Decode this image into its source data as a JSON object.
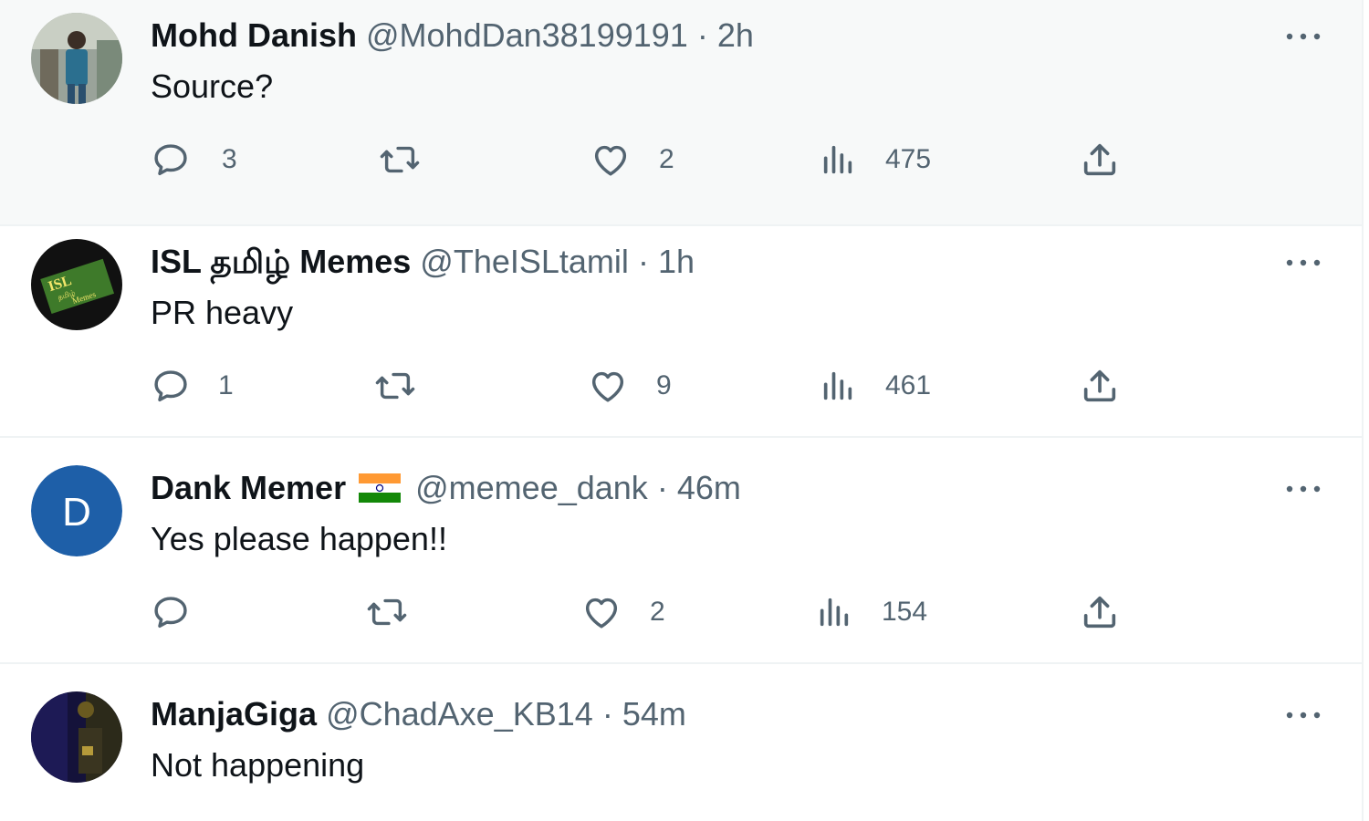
{
  "colors": {
    "text_primary": "#0f1419",
    "text_secondary": "#536471",
    "divider": "#eff3f4",
    "highlight_bg": "#f7f9f9"
  },
  "tweets": [
    {
      "name": "Mohd Danish",
      "handle": "@MohdDan38199191",
      "separator": "·",
      "time": "2h",
      "text": "Source?",
      "replies": "3",
      "likes": "2",
      "views": "475",
      "avatar_icon": "person-photo-avatar"
    },
    {
      "name": "ISL தமிழ் Memes",
      "handle": "@TheISLtamil",
      "separator": "·",
      "time": "1h",
      "text": "PR heavy",
      "replies": "1",
      "likes": "9",
      "views": "461",
      "avatar_icon": "isl-logo-avatar"
    },
    {
      "name": "Dank Memer",
      "name_emoji": "india-flag",
      "handle": "@memee_dank",
      "separator": "·",
      "time": "46m",
      "text": "Yes please happen!!",
      "replies": "",
      "likes": "2",
      "views": "154",
      "avatar_letter": "D",
      "avatar_color": "#1e5fa8"
    },
    {
      "name": "ManjaGiga",
      "handle": "@ChadAxe_KB14",
      "separator": "·",
      "time": "54m",
      "text": "Not happening",
      "avatar_icon": "dark-photo-avatar"
    }
  ]
}
